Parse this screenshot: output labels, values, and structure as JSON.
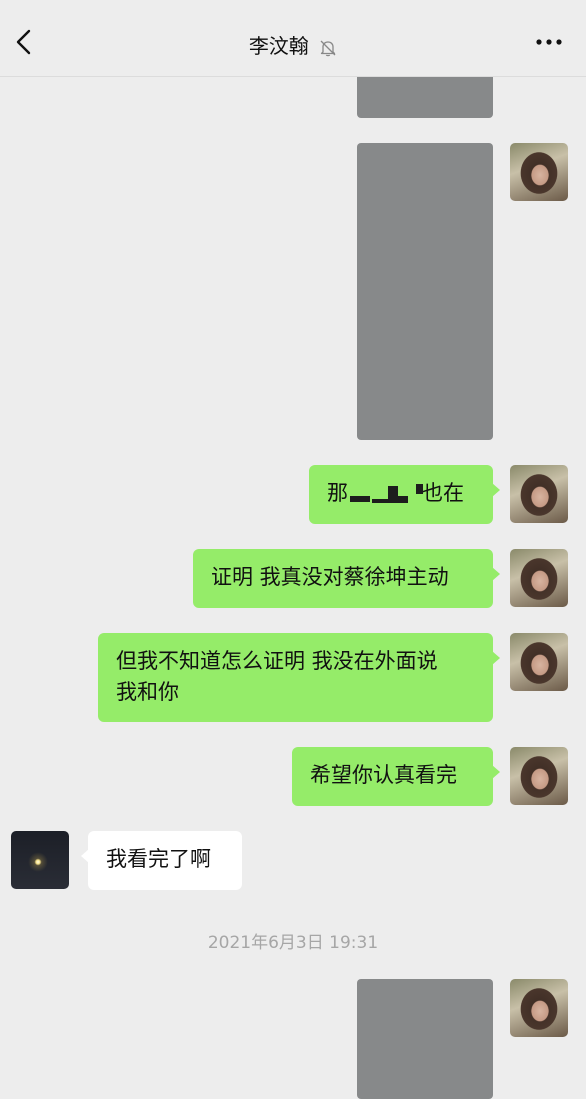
{
  "header": {
    "title": "李汶翰",
    "back_icon": "chevron-left-icon",
    "mute_icon": "bell-off-icon",
    "more_icon": "ellipsis-icon"
  },
  "messages": [
    {
      "side": "right",
      "type": "image-redacted"
    },
    {
      "side": "right",
      "type": "image-redacted"
    },
    {
      "side": "right",
      "type": "text",
      "text_before": "那",
      "text_after": "也在",
      "redacted": true
    },
    {
      "side": "right",
      "type": "text",
      "text": "证明 我真没对蔡徐坤主动"
    },
    {
      "side": "right",
      "type": "text",
      "line1": "但我不知道怎么证明 我没在外面说",
      "line2": "我和你"
    },
    {
      "side": "right",
      "type": "text",
      "text": "希望你认真看完"
    },
    {
      "side": "left",
      "type": "text",
      "text": "我看完了啊"
    },
    {
      "side": "right",
      "type": "image-redacted"
    }
  ],
  "timestamp": "2021年6月3日 19:31",
  "colors": {
    "background": "#ededed",
    "bubble_self": "#95ec69",
    "bubble_other": "#ffffff",
    "redacted_image": "#87898a",
    "timestamp_text": "#a6a6a6"
  }
}
